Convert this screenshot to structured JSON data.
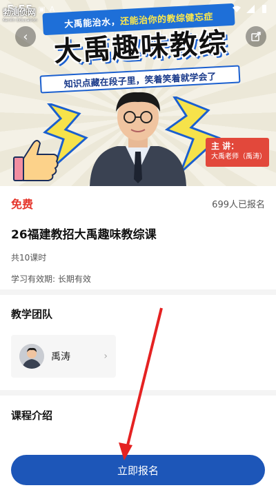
{
  "status_bar": {
    "time": "5:55",
    "notif_icons": [
      "app-icon",
      "A"
    ]
  },
  "banner": {
    "brand_name": "勃测侦网",
    "brand_sub": "Kenlin Education",
    "slogan_part1": "大禹能治水，",
    "slogan_part2": "还能治你的教综健忘症",
    "title": "大禹趣味教综",
    "subtitle": "知识点藏在段子里，笑着笑着就学会了",
    "lecturer_label": "主 讲：",
    "lecturer_name": "大禹老师（禹涛）"
  },
  "course": {
    "price": "免费",
    "enroll_count": "699人已报名",
    "title": "26福建教招大禹趣味教综课",
    "lessons": "共10课时",
    "validity": "学习有效期: 长期有效"
  },
  "team": {
    "heading": "教学团队",
    "teacher_name": "禹涛"
  },
  "intro": {
    "heading": "课程介绍"
  },
  "cta": {
    "label": "立即报名"
  },
  "colors": {
    "accent": "#1d56b8",
    "price": "#e5352b",
    "annotation": "#e52222"
  }
}
